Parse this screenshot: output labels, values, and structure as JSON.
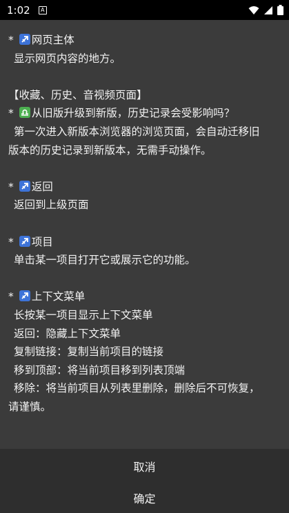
{
  "status": {
    "time": "1:02",
    "notification": "A"
  },
  "icons": {
    "arrow_emoji": "sagittarius-icon",
    "scale_emoji": "libra-icon"
  },
  "sections": {
    "main": {
      "title": "网页主体",
      "desc": "显示网页内容的地方。"
    },
    "history": {
      "header": "【收藏、历史、音视频页面】",
      "question": "从旧版升级到新版，历史记录会受影响吗？",
      "answer_line1": "第一次进入新版本浏览器的浏览页面，会自动迁移旧",
      "answer_line2": "版本的历史记录到新版本，无需手动操作。"
    },
    "back": {
      "title": "返回",
      "desc": "返回到上级页面"
    },
    "item": {
      "title": "项目",
      "desc": "单击某一项目打开它或展示它的功能。"
    },
    "context": {
      "title": "上下文菜单",
      "lines": [
        "长按某一项目显示上下文菜单",
        "返回：隐藏上下文菜单",
        "复制链接：复制当前项目的链接",
        "移到顶部：将当前项目移到列表顶端",
        "移除：将当前项目从列表里删除，删除后不可恢复，"
      ],
      "last_line": "请谨慎。"
    }
  },
  "footer": {
    "cancel": "取消",
    "confirm": "确定"
  },
  "colors": {
    "emoji_blue": "#3d73d8",
    "emoji_green": "#4caf50"
  }
}
